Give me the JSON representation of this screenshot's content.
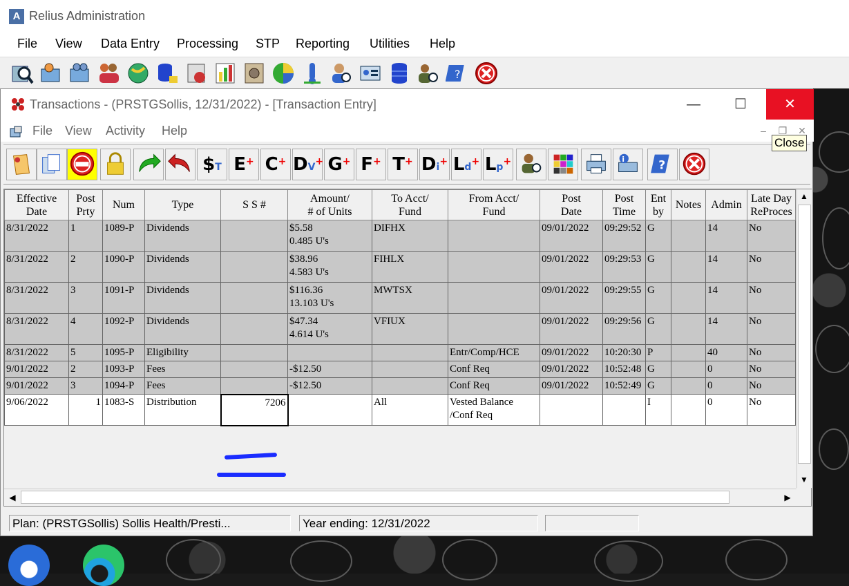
{
  "main_window": {
    "title": "Relius Administration",
    "app_icon_letter": "A",
    "menu": [
      "File",
      "View",
      "Data Entry",
      "Processing",
      "STP",
      "Reporting",
      "Utilities",
      "Help"
    ]
  },
  "tx_window": {
    "title": "Transactions - (PRSTGSollis, 12/31/2022) - [Transaction Entry]",
    "menu": [
      "File",
      "View",
      "Activity",
      "Help"
    ],
    "tooltip": "Close",
    "toolbar_text_buttons": [
      {
        "base": "$",
        "sub": "T"
      },
      {
        "base": "E",
        "sup": "+"
      },
      {
        "base": "C",
        "sup": "+"
      },
      {
        "base": "D",
        "sub": "V",
        "sup": "+"
      },
      {
        "base": "G",
        "sup": "+"
      },
      {
        "base": "F",
        "sup": "+"
      },
      {
        "base": "T",
        "sup": "+"
      },
      {
        "base": "D",
        "sub": "i",
        "sup": "+"
      },
      {
        "base": "L",
        "sub": "d",
        "sup": "+"
      },
      {
        "base": "L",
        "sub": "p",
        "sup": "+"
      }
    ]
  },
  "grid": {
    "columns": [
      "Effective\nDate",
      "Post\nPrty",
      "Num",
      "Type",
      "S S #",
      "Amount/\n# of Units",
      "To Acct/\nFund",
      "From Acct/\nFund",
      "Post\nDate",
      "Post\nTime",
      "Ent\nby",
      "Notes",
      "Admin",
      "Late Day\nReProces"
    ],
    "rows": [
      [
        "8/31/2022",
        "1",
        "1089-P",
        "Dividends",
        "",
        "$5.58\n0.485 U's",
        "DIFHX",
        "",
        "09/01/2022",
        "09:29:52",
        "G",
        "",
        "14",
        "No"
      ],
      [
        "8/31/2022",
        "2",
        "1090-P",
        "Dividends",
        "",
        "$38.96\n4.583 U's",
        "FIHLX",
        "",
        "09/01/2022",
        "09:29:53",
        "G",
        "",
        "14",
        "No"
      ],
      [
        "8/31/2022",
        "3",
        "1091-P",
        "Dividends",
        "",
        "$116.36\n13.103 U's",
        "MWTSX",
        "",
        "09/01/2022",
        "09:29:55",
        "G",
        "",
        "14",
        "No"
      ],
      [
        "8/31/2022",
        "4",
        "1092-P",
        "Dividends",
        "",
        "$47.34\n4.614 U's",
        "VFIUX",
        "",
        "09/01/2022",
        "09:29:56",
        "G",
        "",
        "14",
        "No"
      ],
      [
        "8/31/2022",
        "5",
        "1095-P",
        "Eligibility",
        "",
        "",
        "",
        "Entr/Comp/HCE",
        "09/01/2022",
        "10:20:30",
        "P",
        "",
        "40",
        "No"
      ],
      [
        "9/01/2022",
        "2",
        "1093-P",
        "Fees",
        "",
        "-$12.50",
        "",
        "Conf Req",
        "09/01/2022",
        "10:52:48",
        "G",
        "",
        "0",
        "No"
      ],
      [
        "9/01/2022",
        "3",
        "1094-P",
        "Fees",
        "",
        "-$12.50",
        "",
        "Conf Req",
        "09/01/2022",
        "10:52:49",
        "G",
        "",
        "0",
        "No"
      ],
      [
        "9/06/2022",
        "1",
        "1083-S",
        "Distribution",
        "7206",
        "",
        "All",
        "Vested Balance\n/Conf Req",
        "",
        "",
        "I",
        "",
        "0",
        "No"
      ]
    ]
  },
  "status": {
    "plan": "Plan: (PRSTGSollis) Sollis Health/Presti...",
    "year": "Year ending: 12/31/2022",
    "extra": ""
  },
  "colors": {
    "highlight": "#ffff00",
    "close_red": "#e81123",
    "row_gray": "#c8c8c8",
    "redaction_blue": "#1a2cff"
  }
}
